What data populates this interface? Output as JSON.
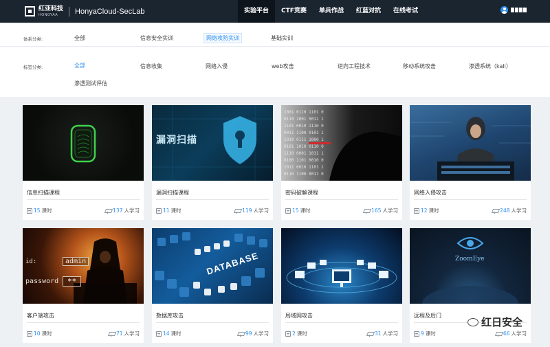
{
  "header": {
    "logo_cn": "红亚科技",
    "logo_en": "HONGYAA",
    "app_title": "HonyaCloud-SecLab",
    "nav": [
      "实验平台",
      "CTF竞赛",
      "单兵作战",
      "红蓝对抗",
      "在线考试"
    ],
    "active_nav": "实验平台"
  },
  "filters": {
    "system": {
      "label": "体系分类:",
      "options": [
        "全部",
        "信息安全实训",
        "网络攻防实训",
        "基础实训"
      ],
      "active": "网络攻防实训"
    },
    "tags": {
      "label": "标签分类:",
      "options": [
        "全部",
        "信息收集",
        "网络入侵",
        "web攻击",
        "逆向工程技术",
        "移动系统攻击",
        "渗透系统（kali）",
        "渗透测试评估"
      ],
      "active": "全部"
    }
  },
  "courses": [
    {
      "title": "信息扫描课程",
      "lessons": "15",
      "lessons_unit": "课时",
      "learners": "137",
      "learners_unit": "人学习",
      "thumb_text": "",
      "thumb_icon": "fingerprint-icon"
    },
    {
      "title": "漏洞扫描课程",
      "lessons": "11",
      "lessons_unit": "课时",
      "learners": "119",
      "learners_unit": "人学习",
      "thumb_text": "漏洞扫描",
      "thumb_icon": "shield-lock-icon"
    },
    {
      "title": "密码破解课程",
      "lessons": "15",
      "lessons_unit": "课时",
      "learners": "165",
      "learners_unit": "人学习",
      "thumb_text": "",
      "thumb_icon": "binary-hand-icon"
    },
    {
      "title": "网络入侵攻击",
      "lessons": "12",
      "lessons_unit": "课时",
      "learners": "248",
      "learners_unit": "人学习",
      "thumb_text": "",
      "thumb_icon": "hacker-icon"
    },
    {
      "title": "客户端攻击",
      "lessons": "10",
      "lessons_unit": "课时",
      "learners": "71",
      "learners_unit": "人学习",
      "thumb_text": "admin",
      "thumb_text2": "password",
      "thumb_text3": "**",
      "thumb_text4": "id:",
      "thumb_icon": "hooded-hacker-icon"
    },
    {
      "title": "数据库攻击",
      "lessons": "14",
      "lessons_unit": "课时",
      "learners": "99",
      "learners_unit": "人学习",
      "thumb_text": "DATABASE",
      "thumb_icon": "database-icon"
    },
    {
      "title": "局域网攻击",
      "lessons": "2",
      "lessons_unit": "课时",
      "learners": "31",
      "learners_unit": "人学习",
      "thumb_text": "",
      "thumb_icon": "network-icon"
    },
    {
      "title": "远程及后门",
      "lessons": "9",
      "lessons_unit": "课时",
      "learners": "66",
      "learners_unit": "人学习",
      "thumb_text": "ZoomEye",
      "thumb_icon": "eye-icon"
    }
  ],
  "watermark": "红日安全",
  "colors": {
    "topbar": "#1b2530",
    "accent": "#2d8ff0",
    "page_bg": "#eef1f4"
  }
}
